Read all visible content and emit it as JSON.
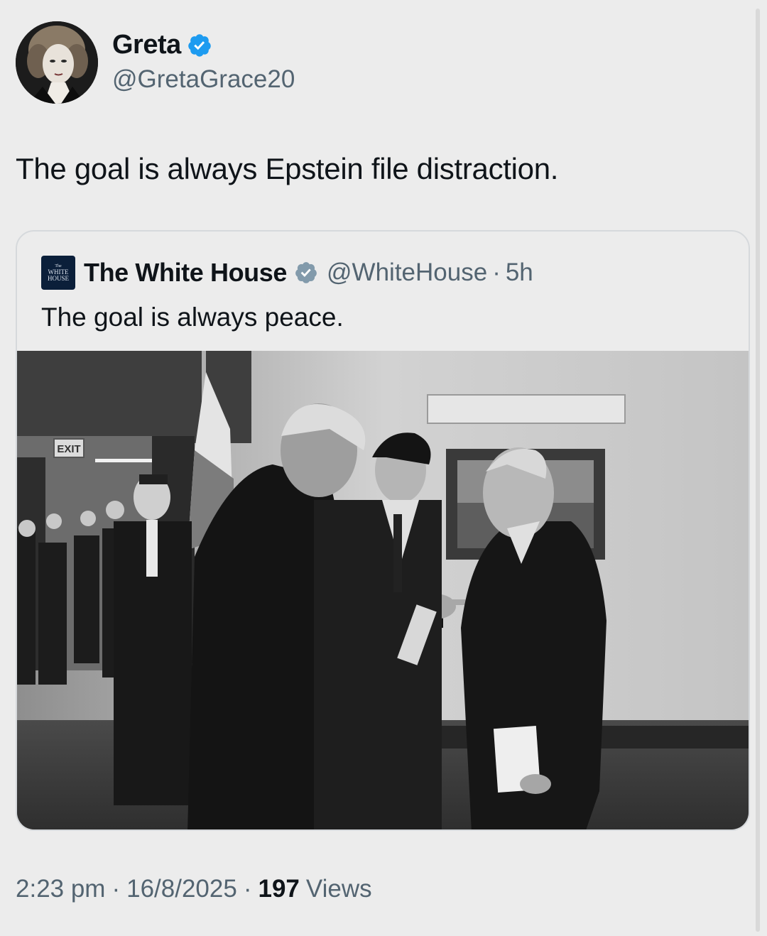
{
  "author": {
    "name": "Greta",
    "handle": "@GretaGrace20",
    "verified": true
  },
  "tweet": {
    "text": "The goal is always Epstein file distraction."
  },
  "quoted": {
    "avatar_text": [
      "The",
      "WHITE",
      "HOUSE"
    ],
    "name": "The White House",
    "handle": "@WhiteHouse",
    "separator": "·",
    "age": "5h",
    "text": "The goal is always peace.",
    "photo_sign_text": "EXIT"
  },
  "meta": {
    "time": "2:23 pm",
    "separator": "·",
    "date": "16/8/2025",
    "views_count": "197",
    "views_label": "Views"
  },
  "colors": {
    "verified_blue": "#1d9bf0",
    "secondary_text": "#536471",
    "primary_text": "#0f1419"
  }
}
